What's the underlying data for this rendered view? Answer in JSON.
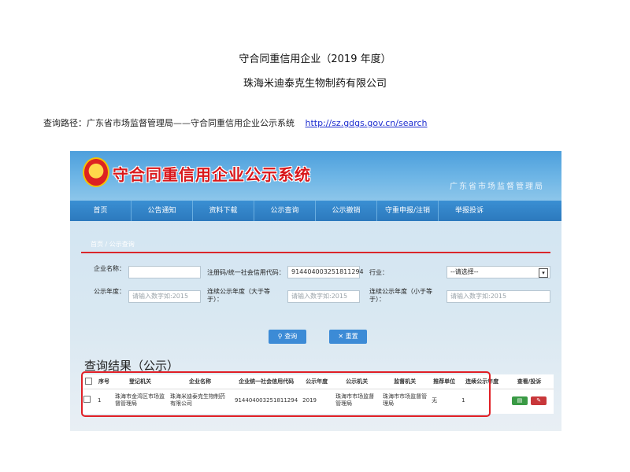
{
  "document": {
    "title": "守合同重信用企业（2019 年度）",
    "company": "珠海米迪泰克生物制药有限公司",
    "path_label": "查询路径：广东省市场监督管理局——守合同重信用企业公示系统",
    "path_url": "http://sz.gdgs.gov.cn/search"
  },
  "site": {
    "system_title": "守合同重信用企业公示系统",
    "bureau": "广东省市场监督管理局",
    "nav": [
      "首页",
      "公告通知",
      "资料下载",
      "公示查询",
      "公示撤销",
      "守重申报/注销",
      "举报投诉"
    ],
    "breadcrumb": "首页 / 公示查询"
  },
  "search_form": {
    "company_name_label": "企业名称：",
    "company_name_value": "",
    "credit_code_label": "注册码/统一社会信用代码：",
    "credit_code_value": "914404003251811294",
    "industry_label": "行业：",
    "industry_value": "--请选择--",
    "year_label": "公示年度：",
    "year_placeholder": "请输入数字如:2015",
    "consec_gte_label": "连续公示年度（大于等于）：",
    "consec_gte_placeholder": "请输入数字如:2015",
    "consec_lte_label": "连续公示年度（小于等于）：",
    "consec_lte_placeholder": "请输入数字如:2015",
    "search_button": "查询",
    "reset_button": "重置",
    "search_icon": "search-icon",
    "reset_icon": "reset-icon"
  },
  "results": {
    "title": "查询结果（公示）",
    "columns": [
      "序号",
      "登记机关",
      "企业名称",
      "企业统一社会信用代码",
      "公示年度",
      "公示机关",
      "监督机关",
      "推荐单位",
      "连续公示年度",
      "查看/投诉"
    ],
    "rows": [
      {
        "no": "1",
        "registration_authority": "珠海市金湾区市场监督管理局",
        "company_name": "珠海米迪泰克生物制药有限公司",
        "credit_code": "914404003251811294",
        "year": "2019",
        "publicity_authority": "珠海市市场监督管理局",
        "supervisory_authority": "珠海市市场监督管理局",
        "recommending_unit": "无",
        "consecutive_years": "1"
      }
    ]
  },
  "colors": {
    "nav_blue": "#2c79bd",
    "title_red": "#d9181b",
    "highlight_red": "#e01f26",
    "link_blue": "#1f2fd0"
  }
}
